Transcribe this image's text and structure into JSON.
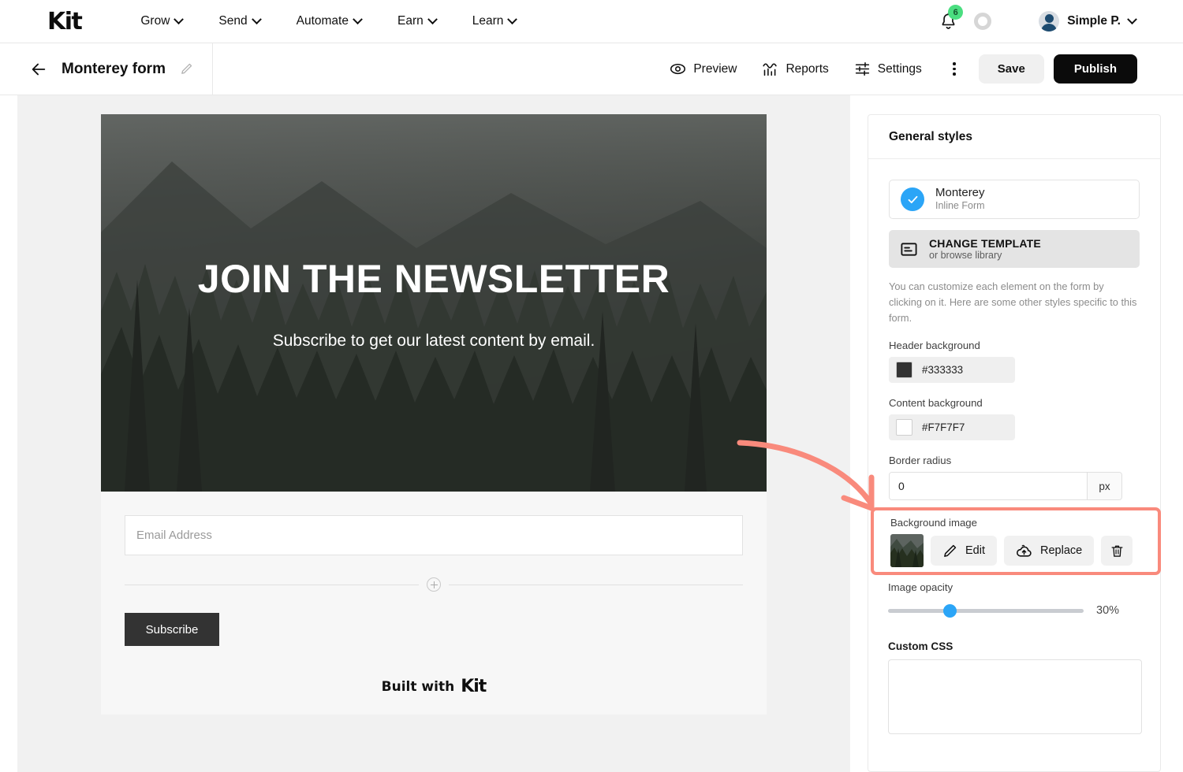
{
  "topnav": {
    "brand": "Kit",
    "links": [
      {
        "label": "Grow",
        "icon": "chevron-down-icon"
      },
      {
        "label": "Send",
        "icon": "chevron-down-icon"
      },
      {
        "label": "Automate",
        "icon": "chevron-down-icon"
      },
      {
        "label": "Earn",
        "icon": "chevron-down-icon"
      },
      {
        "label": "Learn",
        "icon": "chevron-down-icon"
      }
    ],
    "notification_count": "6",
    "notification_icon": "bell-icon",
    "progress_ring_icon": "progress-ring-icon",
    "user_name": "Simple P.",
    "user_caret_icon": "chevron-down-icon",
    "avatar_icon": "avatar-icon"
  },
  "subbar": {
    "back_icon": "back-arrow-icon",
    "form_title": "Monterey form",
    "edit_icon": "pencil-icon",
    "tools": [
      {
        "label": "Preview",
        "icon": "eye-icon"
      },
      {
        "label": "Reports",
        "icon": "chart-icon"
      },
      {
        "label": "Settings",
        "icon": "sliders-icon"
      }
    ],
    "more_icon": "kebab-menu-icon",
    "save_label": "Save",
    "publish_label": "Publish"
  },
  "form_preview": {
    "heading": "JOIN THE NEWSLETTER",
    "subheading": "Subscribe to get our latest content by email.",
    "email_placeholder": "Email Address",
    "add_block_icon": "plus-circle-icon",
    "subscribe_label": "Subscribe",
    "built_with_text": "Built with",
    "built_with_brand": "Kit"
  },
  "panel": {
    "title": "General styles",
    "template": {
      "name": "Monterey",
      "type": "Inline Form",
      "selected_icon": "check-circle-icon"
    },
    "change_template": {
      "title": "CHANGE TEMPLATE",
      "subtitle": "or browse library",
      "icon": "template-icon"
    },
    "help_text": "You can customize each element on the form by clicking on it. Here are some other styles specific to this form.",
    "header_background": {
      "label": "Header background",
      "value": "#333333",
      "swatch": "#333333"
    },
    "content_background": {
      "label": "Content background",
      "value": "#F7F7F7",
      "swatch": "#FFFFFF"
    },
    "border_radius": {
      "label": "Border radius",
      "value": "0",
      "unit": "px"
    },
    "background_image": {
      "label": "Background image",
      "thumbnail_icon": "image-thumbnail",
      "edit_label": "Edit",
      "edit_icon": "pencil-icon",
      "replace_label": "Replace",
      "replace_icon": "cloud-upload-icon",
      "delete_icon": "trash-icon",
      "highlight_color": "#F98A7C"
    },
    "image_opacity": {
      "label": "Image opacity",
      "value": "30%",
      "percent": 30,
      "accent_color": "#2BA5F7"
    },
    "custom_css": {
      "label": "Custom CSS",
      "value": ""
    }
  },
  "annotation": {
    "arrow_color": "#F98A7C",
    "arrow_icon": "curved-arrow-annotation"
  }
}
